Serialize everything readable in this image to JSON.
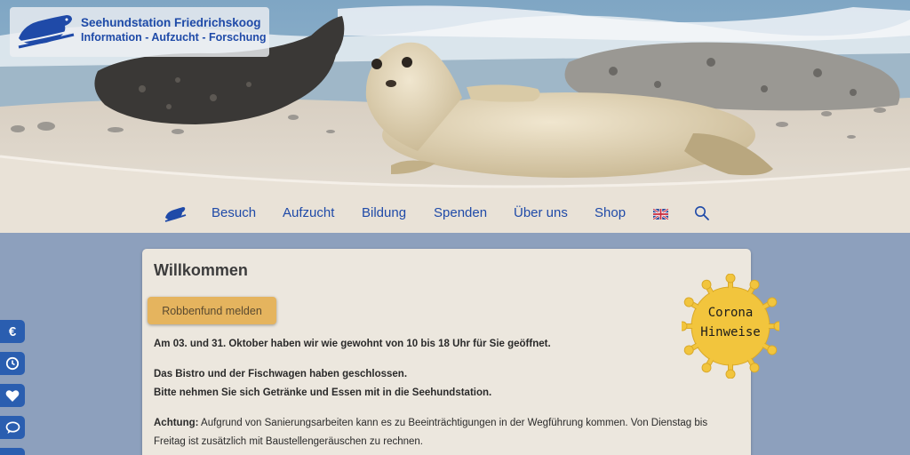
{
  "header": {
    "logo_title": "Seehundstation Friedrichskoog",
    "logo_subtitle": "Information - Aufzucht - Forschung"
  },
  "nav": {
    "items": [
      {
        "label": "Besuch"
      },
      {
        "label": "Aufzucht"
      },
      {
        "label": "Bildung"
      },
      {
        "label": "Spenden"
      },
      {
        "label": "Über uns"
      },
      {
        "label": "Shop"
      }
    ]
  },
  "main": {
    "title": "Willkommen",
    "report_button": "Robbenfund melden",
    "p1": "Am 03. und 31. Oktober haben wir wie gewohnt von 10 bis 18 Uhr für Sie geöffnet.",
    "p2_line1": "Das Bistro und der Fischwagen haben geschlossen.",
    "p2_line2": "Bitte nehmen Sie sich Getränke und Essen mit in die Seehundstation.",
    "p3_label": "Achtung:",
    "p3_text": "Aufgrund von Sanierungsarbeiten kann es zu Beeinträchtigungen in der Wegführung kommen. Von Dienstag bis Freitag ist zusätzlich mit Baustellengeräuschen zu rechnen."
  },
  "corona": {
    "line1": "Corona",
    "line2": "Hinweise"
  },
  "side_buttons": [
    {
      "icon": "euro-icon",
      "glyph": "€"
    },
    {
      "icon": "clock-icon"
    },
    {
      "icon": "heart-icon"
    },
    {
      "icon": "chat-icon"
    }
  ],
  "colors": {
    "brand_blue": "#1f4aa8",
    "page_bg": "#8da0bd",
    "card_bg": "#ece7de",
    "button_orange": "#e5b45e",
    "corona_yellow": "#f2c53d"
  }
}
